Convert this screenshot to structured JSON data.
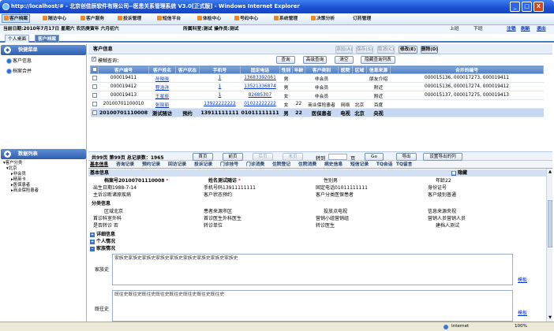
{
  "window": {
    "title": "http://localhost/# - 北京创佳辰软件有限公司--医患关系管理系统 V3.0[正式版] - Windows Internet Explorer",
    "min": "_",
    "max": "□",
    "close": "X"
  },
  "menu": [
    "客户档案",
    "随访中心",
    "客户服务",
    "投诉管理",
    "短信平台",
    "体检中心",
    "号码中心",
    "系统管理",
    "决策分析",
    "订药管理"
  ],
  "info": {
    "date": "当前日期:2010年7月17日 星期六 农历庚寅年 六月初六",
    "dept": "所属科室:测试 操作员:测试",
    "prev": "上班",
    "next": "下班",
    "logout": "注销",
    "refresh": "刷新",
    "exit": "退出"
  },
  "tabs": [
    "个人桌面",
    "客户档案"
  ],
  "left": {
    "quick_title": "快捷菜单",
    "nav": [
      "客户信息",
      "档案合并"
    ],
    "data_title": "数据列表",
    "tree": [
      "客户分类",
      "北京",
      "非会员",
      "精英卡",
      "医保患者",
      "商业保险患者"
    ]
  },
  "main": {
    "title": "客户信息",
    "topbuttons": [
      "添加(A)",
      "保存(S)",
      "取消(C)",
      "修改(E)",
      "删除(D)"
    ],
    "fuzzy_label": "模糊查询：",
    "searchbuttons": [
      "查询",
      "高级查询",
      "清空",
      "隐藏查询列表"
    ],
    "columns": [
      "客户编号",
      "客户姓名",
      "客户状态",
      "手机号",
      "固定电话",
      "性别",
      "年龄",
      "客户类别",
      "医院",
      "区域",
      "信息来源",
      "合并的编号"
    ],
    "rows": [
      [
        "000019411",
        "孙晓晓",
        "",
        "1",
        "13683392061",
        "男",
        "",
        "非会员",
        "",
        "",
        "朋友介绍",
        "000015136, 000017273, 000019411"
      ],
      [
        "000019412",
        "程浩洋",
        "",
        "1",
        "13521336874",
        "男",
        "",
        "非会员",
        "",
        "",
        "附近",
        "000015136, 000017274, 000019412"
      ],
      [
        "000019413",
        "王星辰",
        "",
        "1",
        "82685307",
        "女",
        "",
        "非会员",
        "",
        "",
        "附近",
        "000015137, 000017275, 000019413"
      ],
      [
        "20100701100010",
        "张丽丽",
        "",
        "13922222222",
        "01022222222",
        "女",
        "22",
        "商业保险患者",
        "网络",
        "北京",
        "百度",
        ""
      ],
      [
        "20100701110008",
        "测试随访",
        "预约",
        "13911111111",
        "01011111111",
        "男",
        "22",
        "医保患者",
        "电视",
        "北京",
        "央视",
        ""
      ]
    ],
    "pager": {
      "total": "共99页 第99页 总记录数：1965",
      "first": "首页",
      "prev": "前页",
      "next": "后页",
      "last": "末页",
      "goto": "转到",
      "page": "页",
      "go": "Go",
      "export": "导出",
      "export_settings": "设置导出的列"
    },
    "subtabs": [
      "基本信息",
      "咨询记录",
      "预约记录",
      "回访记录",
      "投诉记录",
      "门诊挂号",
      "门诊消费",
      "住院登记",
      "住院消费",
      "病史信息",
      "短信记录",
      "TQ会话",
      "TQ留言"
    ],
    "detail": {
      "basic_section": "基本信息",
      "fold": "隐藏",
      "archive_no": "档案号20100701110008",
      "name": "姓名测试随访",
      "gender": "性别男",
      "age": "年龄22",
      "birth": "出生日期1988-7-14",
      "mobile": "手机号码13911111111",
      "phone": "固定电话01011111111",
      "idcard": "身份证号",
      "diagnosis": "主诉诊断诸原疾病",
      "status": "客户状态预约",
      "category": "客户分类医保患者",
      "level": "客户级别普通",
      "class_section": "分类信息",
      "region": "区域北京",
      "source_region": "患者来源市区",
      "media": "投放点电视",
      "info_source": "信息来源央视",
      "first_dept": "首诊科室外科",
      "first_doctor": "首诊医生外科医生",
      "sales": "营销小组营销组",
      "sales_person": "营销人员营销人员",
      "transfer": "是否转诊 否",
      "transfer_unit": "转诊单位",
      "transfer_doctor": "转诊医生",
      "builder": "建档人测试",
      "sections": [
        "详细信息",
        "个人情况",
        "家族情况"
      ],
      "family_label": "家族史",
      "family_text": "家族史家族史家族史家族史家族史家族史家族史家族史家族史",
      "past_label": "既往史",
      "past_text": "既往史既往史既往史既往史既往史既往史既往史既往史",
      "template": "模板"
    }
  },
  "status": {
    "zone": "Internet",
    "zoom": "100%"
  }
}
